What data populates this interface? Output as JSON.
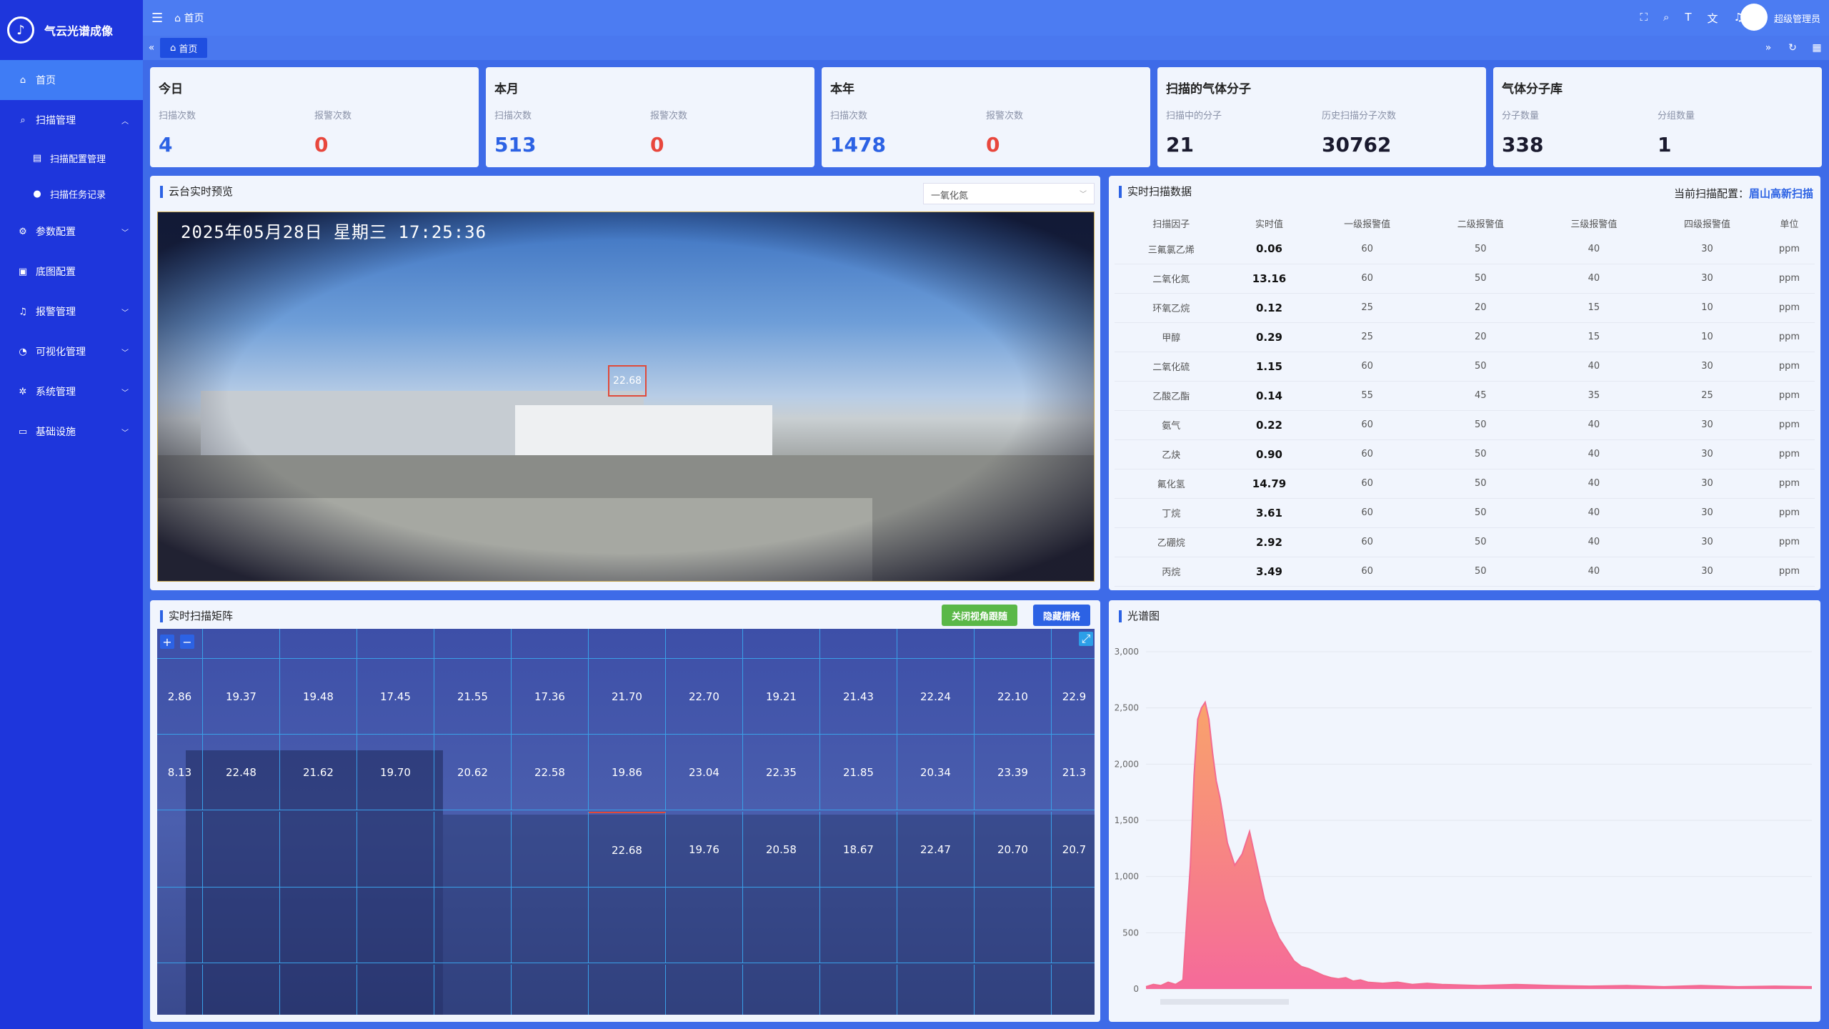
{
  "brand": {
    "name": "气云光谱成像",
    "logo_icon": "logo-mark"
  },
  "sidebar": {
    "items": [
      {
        "label": "首页",
        "icon": "home-icon",
        "active": true
      },
      {
        "label": "扫描管理",
        "icon": "search-icon",
        "expanded": true
      },
      {
        "label": "扫描配置管理",
        "icon": "doc-icon",
        "sub": true
      },
      {
        "label": "扫描任务记录",
        "icon": "user-icon",
        "sub": true
      },
      {
        "label": "参数配置",
        "icon": "gear-icon"
      },
      {
        "label": "底图配置",
        "icon": "image-icon"
      },
      {
        "label": "报警管理",
        "icon": "bell-icon"
      },
      {
        "label": "可视化管理",
        "icon": "chart-icon"
      },
      {
        "label": "系统管理",
        "icon": "settings-icon"
      },
      {
        "label": "基础设施",
        "icon": "monitor-icon"
      }
    ]
  },
  "topbar": {
    "breadcrumb": "首页",
    "user": "超级管理员"
  },
  "tabs": [
    {
      "label": "首页"
    }
  ],
  "stats": [
    {
      "title": "今日",
      "a_label": "扫描次数",
      "a_value": "4",
      "b_label": "报警次数",
      "b_value": "0"
    },
    {
      "title": "本月",
      "a_label": "扫描次数",
      "a_value": "513",
      "b_label": "报警次数",
      "b_value": "0"
    },
    {
      "title": "本年",
      "a_label": "扫描次数",
      "a_value": "1478",
      "b_label": "报警次数",
      "b_value": "0"
    },
    {
      "title": "扫描的气体分子",
      "a_label": "扫描中的分子",
      "a_value": "21",
      "b_label": "历史扫描分子次数",
      "b_value": "30762"
    },
    {
      "title": "气体分子库",
      "a_label": "分子数量",
      "a_value": "338",
      "b_label": "分组数量",
      "b_value": "1"
    }
  ],
  "preview": {
    "title": "云台实时预览",
    "selected_gas": "一氧化氮",
    "osd_date": "2025年05月28日  星期三  17:25:36",
    "target_value": "22.68"
  },
  "scan_data": {
    "title": "实时扫描数据",
    "config_label": "当前扫描配置：",
    "config_value": "眉山高新扫描",
    "headers": [
      "扫描因子",
      "实时值",
      "一级报警值",
      "二级报警值",
      "三级报警值",
      "四级报警值",
      "单位"
    ],
    "rows": [
      [
        "三氟氯乙烯",
        "0.06",
        "60",
        "50",
        "40",
        "30",
        "ppm"
      ],
      [
        "二氧化氮",
        "13.16",
        "60",
        "50",
        "40",
        "30",
        "ppm"
      ],
      [
        "环氧乙烷",
        "0.12",
        "25",
        "20",
        "15",
        "10",
        "ppm"
      ],
      [
        "甲醇",
        "0.29",
        "25",
        "20",
        "15",
        "10",
        "ppm"
      ],
      [
        "二氧化硫",
        "1.15",
        "60",
        "50",
        "40",
        "30",
        "ppm"
      ],
      [
        "乙酸乙酯",
        "0.14",
        "55",
        "45",
        "35",
        "25",
        "ppm"
      ],
      [
        "氨气",
        "0.22",
        "60",
        "50",
        "40",
        "30",
        "ppm"
      ],
      [
        "乙炔",
        "0.90",
        "60",
        "50",
        "40",
        "30",
        "ppm"
      ],
      [
        "氟化氢",
        "14.79",
        "60",
        "50",
        "40",
        "30",
        "ppm"
      ],
      [
        "丁烷",
        "3.61",
        "60",
        "50",
        "40",
        "30",
        "ppm"
      ],
      [
        "乙硼烷",
        "2.92",
        "60",
        "50",
        "40",
        "30",
        "ppm"
      ],
      [
        "丙烷",
        "3.49",
        "60",
        "50",
        "40",
        "30",
        "ppm"
      ]
    ]
  },
  "matrix": {
    "title": "实时扫描矩阵",
    "btn_close": "关闭视角跟随",
    "btn_hide": "隐藏栅格",
    "rows": [
      [
        "2.86",
        "19.37",
        "19.48",
        "17.45",
        "21.55",
        "17.36",
        "21.70",
        "22.70",
        "19.21",
        "21.43",
        "22.24",
        "22.10",
        "22.9"
      ],
      [
        "8.13",
        "22.48",
        "21.62",
        "19.70",
        "20.62",
        "22.58",
        "19.86",
        "23.04",
        "22.35",
        "21.85",
        "20.34",
        "23.39",
        "21.3"
      ],
      [
        "",
        "",
        "",
        "",
        "",
        "",
        "22.68",
        "19.76",
        "20.58",
        "18.67",
        "22.47",
        "20.70",
        "20.7"
      ]
    ]
  },
  "spectrum": {
    "title": "光谱图",
    "chart_data": {
      "type": "area",
      "ylim": [
        0,
        3000
      ],
      "yticks": [
        "0",
        "500",
        "1,000",
        "1,500",
        "2,000",
        "2,500",
        "3,000"
      ],
      "x": [
        0,
        10,
        20,
        30,
        40,
        50,
        55,
        60,
        65,
        70,
        75,
        80,
        85,
        90,
        95,
        100,
        110,
        120,
        130,
        140,
        150,
        160,
        170,
        180,
        190,
        200,
        210,
        220,
        230,
        240,
        250,
        260,
        270,
        280,
        290,
        300,
        320,
        340,
        360,
        380,
        400,
        450,
        500,
        550,
        600,
        650,
        700,
        750,
        800,
        850,
        900
      ],
      "values": [
        20,
        40,
        30,
        60,
        40,
        80,
        600,
        1100,
        1900,
        2400,
        2500,
        2550,
        2400,
        2100,
        1850,
        1700,
        1300,
        1100,
        1200,
        1400,
        1100,
        800,
        600,
        450,
        350,
        250,
        200,
        180,
        150,
        120,
        100,
        90,
        100,
        70,
        80,
        60,
        50,
        60,
        40,
        50,
        40,
        30,
        40,
        30,
        25,
        30,
        20,
        30,
        20,
        25,
        20
      ]
    }
  },
  "colors": {
    "sidebar": "#1e36dc",
    "accent": "#2c62e4",
    "alarm": "#e8473d",
    "spectrum": "#f36b8f"
  }
}
